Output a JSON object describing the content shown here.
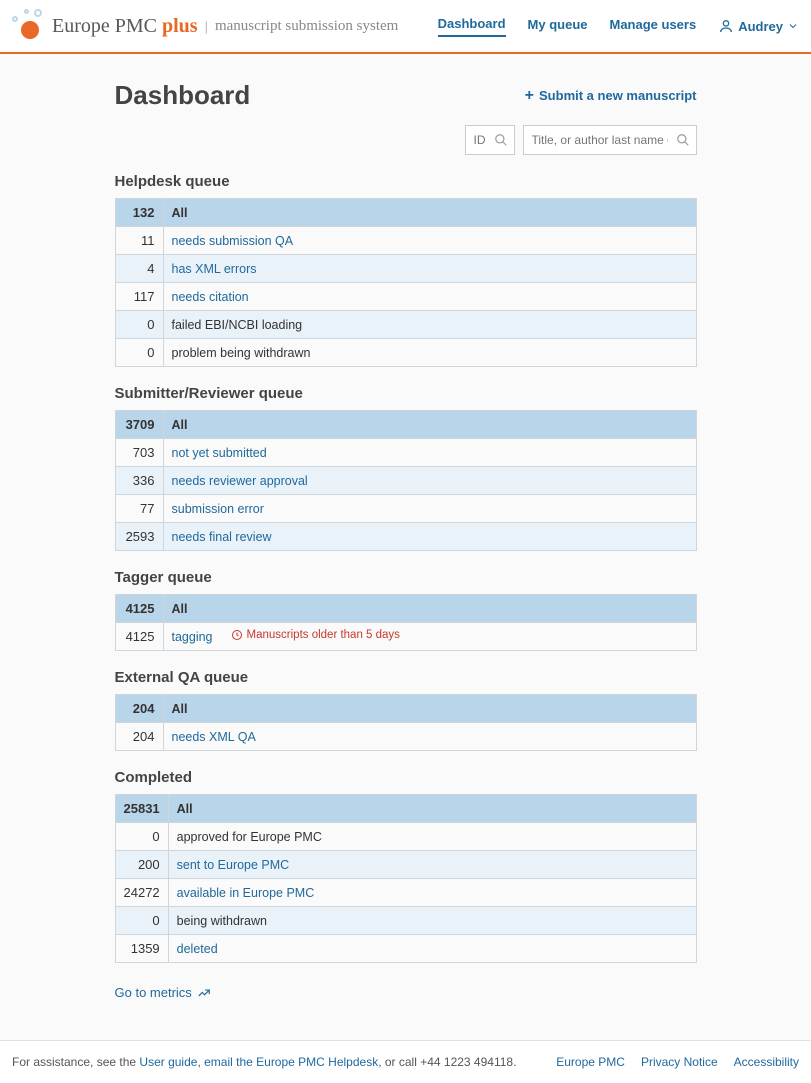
{
  "brand": {
    "name": "Europe PMC",
    "plus": "plus",
    "subtitle": "manuscript submission system"
  },
  "nav": {
    "dashboard": "Dashboard",
    "my_queue": "My queue",
    "manage_users": "Manage users",
    "user_name": "Audrey"
  },
  "page": {
    "title": "Dashboard",
    "submit_label": "Submit a new manuscript",
    "search_id_placeholder": "ID",
    "search_title_placeholder": "Title, or author last name or email",
    "metrics_label": "Go to metrics"
  },
  "sections": {
    "helpdesk": {
      "title": "Helpdesk queue",
      "total": "132",
      "total_label": "All",
      "rows": [
        {
          "count": "11",
          "label": "needs submission QA",
          "link": true
        },
        {
          "count": "4",
          "label": "has XML errors",
          "link": true
        },
        {
          "count": "117",
          "label": "needs citation",
          "link": true
        },
        {
          "count": "0",
          "label": "failed EBI/NCBI loading",
          "link": false
        },
        {
          "count": "0",
          "label": "problem being withdrawn",
          "link": false
        }
      ]
    },
    "submitter": {
      "title": "Submitter/Reviewer queue",
      "total": "3709",
      "total_label": "All",
      "rows": [
        {
          "count": "703",
          "label": "not yet submitted",
          "link": true
        },
        {
          "count": "336",
          "label": "needs reviewer approval",
          "link": true
        },
        {
          "count": "77",
          "label": "submission error",
          "link": true
        },
        {
          "count": "2593",
          "label": "needs final review",
          "link": true
        }
      ]
    },
    "tagger": {
      "title": "Tagger queue",
      "total": "4125",
      "total_label": "All",
      "rows": [
        {
          "count": "4125",
          "label": "tagging",
          "link": true,
          "warning": "Manuscripts older than 5 days"
        }
      ]
    },
    "external": {
      "title": "External QA queue",
      "total": "204",
      "total_label": "All",
      "rows": [
        {
          "count": "204",
          "label": "needs XML QA",
          "link": true
        }
      ]
    },
    "completed": {
      "title": "Completed",
      "total": "25831",
      "total_label": "All",
      "rows": [
        {
          "count": "0",
          "label": "approved for Europe PMC",
          "link": false
        },
        {
          "count": "200",
          "label": "sent to Europe PMC",
          "link": true
        },
        {
          "count": "24272",
          "label": "available in Europe PMC",
          "link": true
        },
        {
          "count": "0",
          "label": "being withdrawn",
          "link": false
        },
        {
          "count": "1359",
          "label": "deleted",
          "link": true
        }
      ]
    }
  },
  "footer": {
    "assist_prefix": "For assistance, see the ",
    "user_guide": "User guide",
    "assist_mid": ", ",
    "email_helpdesk": "email the Europe PMC Helpdesk",
    "assist_suffix": ", or call +44 1223 494118.",
    "europe_pmc": "Europe PMC",
    "privacy": "Privacy Notice",
    "accessibility": "Accessibility"
  }
}
